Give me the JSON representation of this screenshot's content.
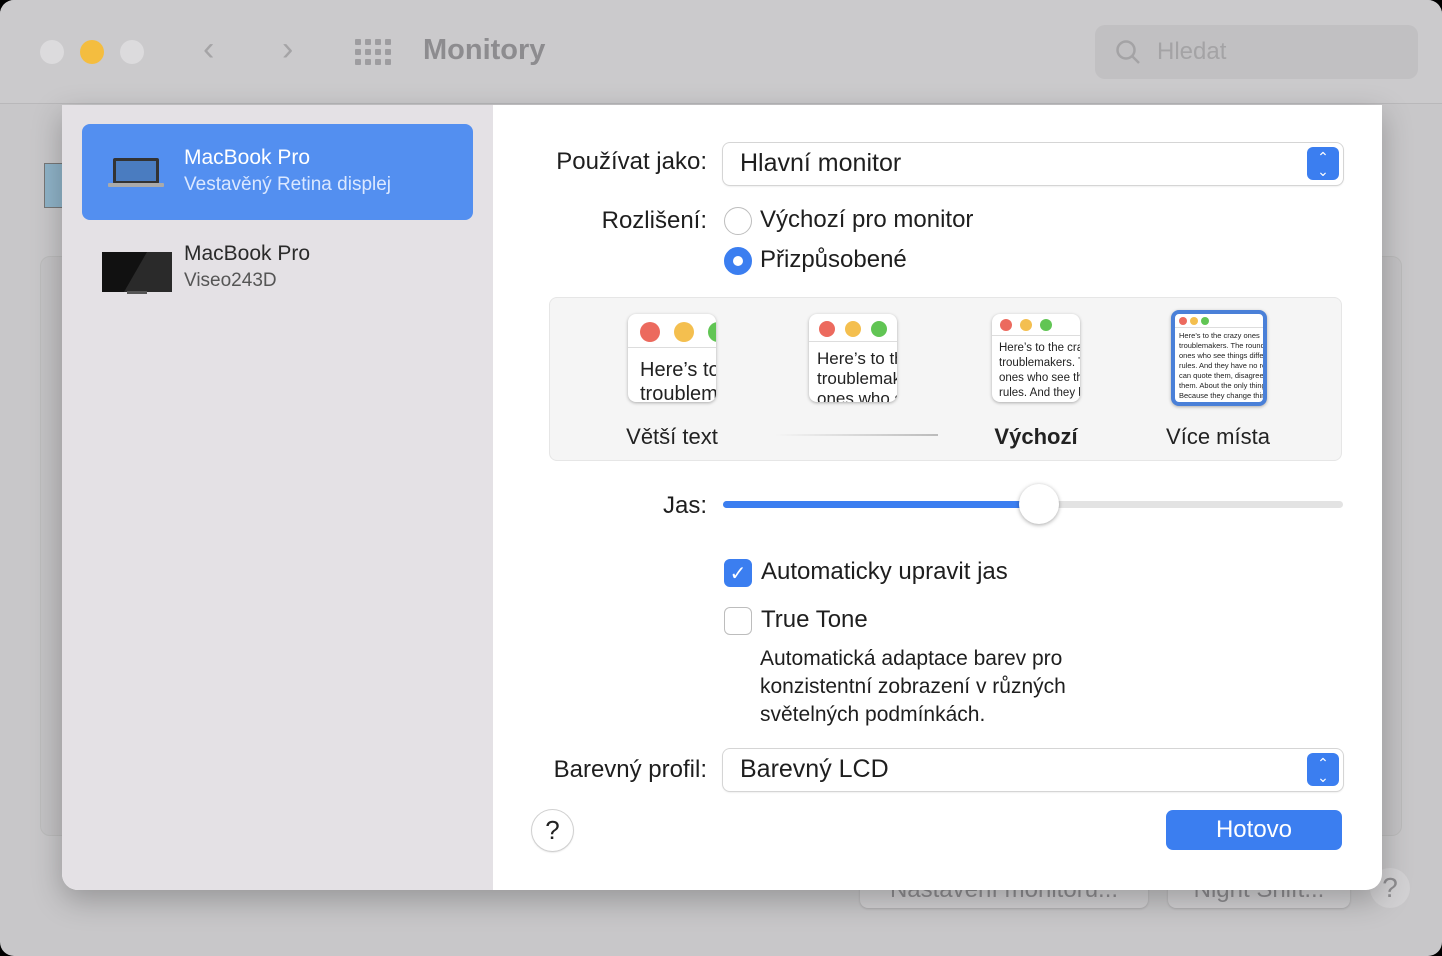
{
  "window": {
    "title": "Monitory",
    "search_placeholder": "Hledat",
    "bg_buttons": [
      "Nastavení monitoru...",
      "Night Shift..."
    ],
    "bg_help": "?"
  },
  "sidebar": {
    "items": [
      {
        "name": "MacBook Pro",
        "subtitle": "Vestavěný Retina displej",
        "selected": true
      },
      {
        "name": "MacBook Pro",
        "subtitle": "Viseo243D",
        "selected": false
      }
    ]
  },
  "settings": {
    "use_as_label": "Používat jako:",
    "use_as_value": "Hlavní monitor",
    "resolution_label": "Rozlišení:",
    "resolution_options": [
      "Výchozí pro monitor",
      "Přizpůsobené"
    ],
    "resolution_selected": 1,
    "scale_options": [
      "Větší text",
      "",
      "Výchozí",
      "Více místa"
    ],
    "scale_selected": 3,
    "preview_text": "Here’s to the crazy ones troublemakers. The round pegs ones who see things differently rules. And they have no respect can quote them, disagree with them. About the only thing Because they change things",
    "brightness_label": "Jas:",
    "brightness": 0.51,
    "auto_brightness_label": "Automaticky upravit jas",
    "auto_brightness": true,
    "true_tone_label": "True Tone",
    "true_tone": false,
    "true_tone_desc": [
      "Automatická adaptace barev pro",
      "konzistentní zobrazení v různých",
      "světelných podmínkách."
    ],
    "color_profile_label": "Barevný profil:",
    "color_profile_value": "Barevný LCD",
    "help": "?",
    "done": "Hotovo"
  },
  "colors": {
    "accent": "#3b7ef0",
    "selection": "#538ff0"
  }
}
